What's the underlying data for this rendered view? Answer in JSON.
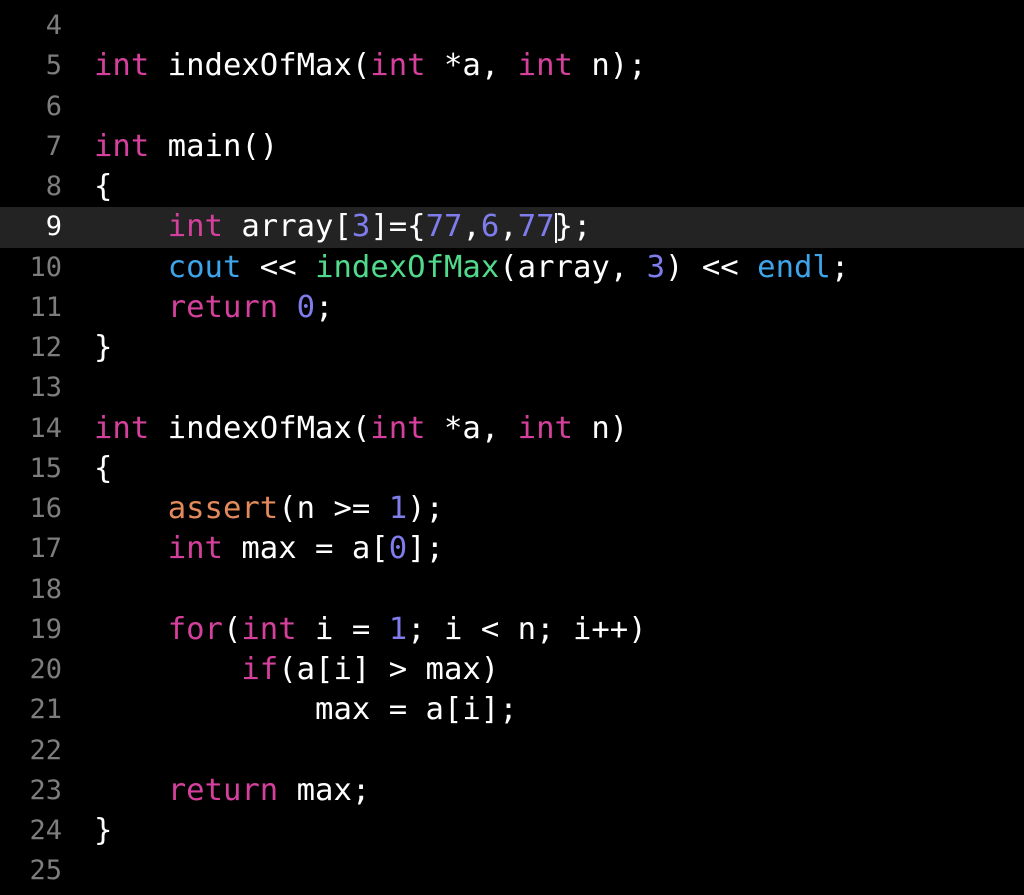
{
  "editor": {
    "current_line": 9,
    "colors": {
      "keyword": "#d4409c",
      "number": "#7f7ceb",
      "system": "#3ea5ea",
      "function": "#52da8c",
      "macro": "#e38a5c",
      "line_number": "#7d7d7d",
      "background": "#000000",
      "current_line_bg": "#232323"
    },
    "lines": [
      {
        "n": "4",
        "tokens": []
      },
      {
        "n": "5",
        "tokens": [
          [
            "int",
            "kw"
          ],
          [
            " indexOfMax(",
            "plain"
          ],
          [
            "int",
            "kw"
          ],
          [
            " *a, ",
            "plain"
          ],
          [
            "int",
            "kw"
          ],
          [
            " n);",
            "plain"
          ]
        ]
      },
      {
        "n": "6",
        "tokens": []
      },
      {
        "n": "7",
        "tokens": [
          [
            "int",
            "kw"
          ],
          [
            " main()",
            "plain"
          ]
        ]
      },
      {
        "n": "8",
        "tokens": [
          [
            "{",
            "plain"
          ]
        ]
      },
      {
        "n": "9",
        "tokens": [
          [
            "    ",
            "plain"
          ],
          [
            "int",
            "kw"
          ],
          [
            " array[",
            "plain"
          ],
          [
            "3",
            "num"
          ],
          [
            "]={",
            "plain"
          ],
          [
            "77",
            "num"
          ],
          [
            ",",
            "plain"
          ],
          [
            "6",
            "num"
          ],
          [
            ",",
            "plain"
          ],
          [
            "77",
            "num"
          ],
          [
            "|",
            "caret"
          ],
          [
            "};",
            "plain"
          ]
        ]
      },
      {
        "n": "10",
        "tokens": [
          [
            "    ",
            "plain"
          ],
          [
            "cout",
            "sys"
          ],
          [
            " << ",
            "plain"
          ],
          [
            "indexOfMax",
            "fn"
          ],
          [
            "(array, ",
            "plain"
          ],
          [
            "3",
            "num"
          ],
          [
            ") << ",
            "plain"
          ],
          [
            "endl",
            "sys"
          ],
          [
            ";",
            "plain"
          ]
        ]
      },
      {
        "n": "11",
        "tokens": [
          [
            "    ",
            "plain"
          ],
          [
            "return",
            "kw"
          ],
          [
            " ",
            "plain"
          ],
          [
            "0",
            "num"
          ],
          [
            ";",
            "plain"
          ]
        ]
      },
      {
        "n": "12",
        "tokens": [
          [
            "}",
            "plain"
          ]
        ]
      },
      {
        "n": "13",
        "tokens": []
      },
      {
        "n": "14",
        "tokens": [
          [
            "int",
            "kw"
          ],
          [
            " indexOfMax(",
            "plain"
          ],
          [
            "int",
            "kw"
          ],
          [
            " *a, ",
            "plain"
          ],
          [
            "int",
            "kw"
          ],
          [
            " n)",
            "plain"
          ]
        ]
      },
      {
        "n": "15",
        "tokens": [
          [
            "{",
            "plain"
          ]
        ]
      },
      {
        "n": "16",
        "tokens": [
          [
            "    ",
            "plain"
          ],
          [
            "assert",
            "mac"
          ],
          [
            "(n >= ",
            "plain"
          ],
          [
            "1",
            "num"
          ],
          [
            ");",
            "plain"
          ]
        ]
      },
      {
        "n": "17",
        "tokens": [
          [
            "    ",
            "plain"
          ],
          [
            "int",
            "kw"
          ],
          [
            " max = a[",
            "plain"
          ],
          [
            "0",
            "num"
          ],
          [
            "];",
            "plain"
          ]
        ]
      },
      {
        "n": "18",
        "tokens": []
      },
      {
        "n": "19",
        "tokens": [
          [
            "    ",
            "plain"
          ],
          [
            "for",
            "kw"
          ],
          [
            "(",
            "plain"
          ],
          [
            "int",
            "kw"
          ],
          [
            " i = ",
            "plain"
          ],
          [
            "1",
            "num"
          ],
          [
            "; i < n; i++)",
            "plain"
          ]
        ]
      },
      {
        "n": "20",
        "tokens": [
          [
            "        ",
            "plain"
          ],
          [
            "if",
            "kw"
          ],
          [
            "(a[i] > max)",
            "plain"
          ]
        ]
      },
      {
        "n": "21",
        "tokens": [
          [
            "            max = a[i];",
            "plain"
          ]
        ]
      },
      {
        "n": "22",
        "tokens": []
      },
      {
        "n": "23",
        "tokens": [
          [
            "    ",
            "plain"
          ],
          [
            "return",
            "kw"
          ],
          [
            " max;",
            "plain"
          ]
        ]
      },
      {
        "n": "24",
        "tokens": [
          [
            "}",
            "plain"
          ]
        ]
      },
      {
        "n": "25",
        "tokens": []
      }
    ]
  }
}
